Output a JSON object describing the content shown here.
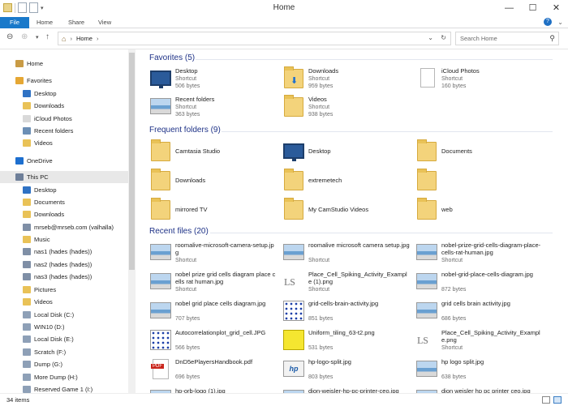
{
  "window": {
    "title": "Home"
  },
  "ribbon": {
    "tabs": [
      "File",
      "Home",
      "Share",
      "View"
    ]
  },
  "address": {
    "path": "Home",
    "search_placeholder": "Search Home"
  },
  "sidebar": {
    "items": [
      {
        "label": "Home",
        "icon": "home-icon",
        "color": "#c99b45"
      },
      {
        "label": "Favorites",
        "icon": "star-icon",
        "color": "#e5a734"
      },
      {
        "label": "Desktop",
        "icon": "desktop-icon",
        "color": "#2f72c4"
      },
      {
        "label": "Downloads",
        "icon": "folder-download-icon",
        "color": "#e9c257"
      },
      {
        "label": "iCloud Photos",
        "icon": "file-icon",
        "color": "#d9d9d9"
      },
      {
        "label": "Recent folders",
        "icon": "recent-icon",
        "color": "#6c8fb5"
      },
      {
        "label": "Videos",
        "icon": "folder-icon",
        "color": "#e9c257"
      },
      {
        "label": "OneDrive",
        "icon": "cloud-icon",
        "color": "#1d6fcf"
      },
      {
        "label": "This PC",
        "icon": "pc-icon",
        "color": "#6e7f99"
      },
      {
        "label": "Desktop",
        "icon": "desktop-icon",
        "color": "#2f72c4"
      },
      {
        "label": "Documents",
        "icon": "folder-icon",
        "color": "#e9c257"
      },
      {
        "label": "Downloads",
        "icon": "folder-download-icon",
        "color": "#e9c257"
      },
      {
        "label": "mrseb@mrseb.com (valhalla)",
        "icon": "network-drive-icon",
        "color": "#7f8fa6"
      },
      {
        "label": "Music",
        "icon": "folder-music-icon",
        "color": "#e9c257"
      },
      {
        "label": "nas1 (hades (hades))",
        "icon": "network-drive-icon",
        "color": "#7f8fa6"
      },
      {
        "label": "nas2 (hades (hades))",
        "icon": "network-drive-icon",
        "color": "#7f8fa6"
      },
      {
        "label": "nas3 (hades (hades))",
        "icon": "network-drive-icon",
        "color": "#7f8fa6"
      },
      {
        "label": "Pictures",
        "icon": "folder-pictures-icon",
        "color": "#e9c257"
      },
      {
        "label": "Videos",
        "icon": "folder-icon",
        "color": "#e9c257"
      },
      {
        "label": "Local Disk (C:)",
        "icon": "drive-icon",
        "color": "#8ea0b7"
      },
      {
        "label": "WIN10 (D:)",
        "icon": "drive-icon",
        "color": "#8ea0b7"
      },
      {
        "label": "Local Disk (E:)",
        "icon": "drive-icon",
        "color": "#8ea0b7"
      },
      {
        "label": "Scratch (F:)",
        "icon": "drive-icon",
        "color": "#8ea0b7"
      },
      {
        "label": "Dump (G:)",
        "icon": "drive-icon",
        "color": "#8ea0b7"
      },
      {
        "label": "More Dump (H:)",
        "icon": "drive-icon",
        "color": "#8ea0b7"
      },
      {
        "label": "Reserved Game 1 (I:)",
        "icon": "drive-icon",
        "color": "#8ea0b7"
      }
    ]
  },
  "groups": {
    "favorites": "Favorites (5)",
    "frequent": "Frequent folders (9)",
    "recent": "Recent files (20)"
  },
  "favorites": [
    {
      "name": "Desktop",
      "type": "Shortcut",
      "size": "506 bytes",
      "kind": "monitor"
    },
    {
      "name": "Downloads",
      "type": "Shortcut",
      "size": "959 bytes",
      "kind": "folder-down"
    },
    {
      "name": "iCloud Photos",
      "type": "Shortcut",
      "size": "160 bytes",
      "kind": "doc"
    },
    {
      "name": "Recent folders",
      "type": "Shortcut",
      "size": "363 bytes",
      "kind": "recent"
    },
    {
      "name": "Videos",
      "type": "Shortcut",
      "size": "938 bytes",
      "kind": "folder"
    }
  ],
  "frequent": [
    {
      "name": "Camtasia Studio",
      "kind": "folder"
    },
    {
      "name": "Desktop",
      "kind": "monitor"
    },
    {
      "name": "Documents",
      "kind": "folder"
    },
    {
      "name": "Downloads",
      "kind": "folder"
    },
    {
      "name": "extremetech",
      "kind": "folder"
    },
    {
      "name": "",
      "kind": "folder"
    },
    {
      "name": "mirrored TV",
      "kind": "folder"
    },
    {
      "name": "My CamStudio Videos",
      "kind": "folder"
    },
    {
      "name": "web",
      "kind": "folder"
    }
  ],
  "recent": [
    {
      "name": "roomalive-microsoft-camera-setup.jpg",
      "sub": "Shortcut",
      "kind": "pic"
    },
    {
      "name": "roomalive microsoft camera setup.jpg",
      "sub": "Shortcut",
      "kind": "pic"
    },
    {
      "name": "nobel-prize-grid-cells-diagram-place-cells-rat-human.jpg",
      "sub": "Shortcut",
      "kind": "pic"
    },
    {
      "name": "nobel prize grid cells diagram place cells rat human.jpg",
      "sub": "Shortcut",
      "kind": "pic"
    },
    {
      "name": "Place_Cell_Spiking_Activity_Example (1).png",
      "sub": "Shortcut",
      "kind": "ls"
    },
    {
      "name": "nobel-grid-place-cells-diagram.jpg",
      "sub": "872 bytes",
      "kind": "pic"
    },
    {
      "name": "nobel grid place cells diagram.jpg",
      "sub": "707 bytes",
      "kind": "pic"
    },
    {
      "name": "grid-cells-brain-activity.jpg",
      "sub": "851 bytes",
      "kind": "dots"
    },
    {
      "name": "grid cells brain activity.jpg",
      "sub": "686 bytes",
      "kind": "pic"
    },
    {
      "name": "Autocorrelationplot_grid_cell.JPG",
      "sub": "566 bytes",
      "kind": "dots"
    },
    {
      "name": "Uniform_tiling_63-t2.png",
      "sub": "531 bytes",
      "kind": "tiling"
    },
    {
      "name": "Place_Cell_Spiking_Activity_Example.png",
      "sub": "Shortcut",
      "kind": "ls"
    },
    {
      "name": "DnD5ePlayersHandbook.pdf",
      "sub": "696 bytes",
      "kind": "pdf"
    },
    {
      "name": "hp-logo-split.jpg",
      "sub": "803 bytes",
      "kind": "hp"
    },
    {
      "name": "hp logo split.jpg",
      "sub": "638 bytes",
      "kind": "pic"
    },
    {
      "name": "hp-orb-logo (1).jpg",
      "sub": "",
      "kind": "pic"
    },
    {
      "name": "dion-weisler-hp-pc-printer-ceo.jpg",
      "sub": "",
      "kind": "pic"
    },
    {
      "name": "dion weisler hp pc printer ceo.jpg",
      "sub": "",
      "kind": "pic"
    }
  ],
  "status": {
    "count": "34 items"
  }
}
